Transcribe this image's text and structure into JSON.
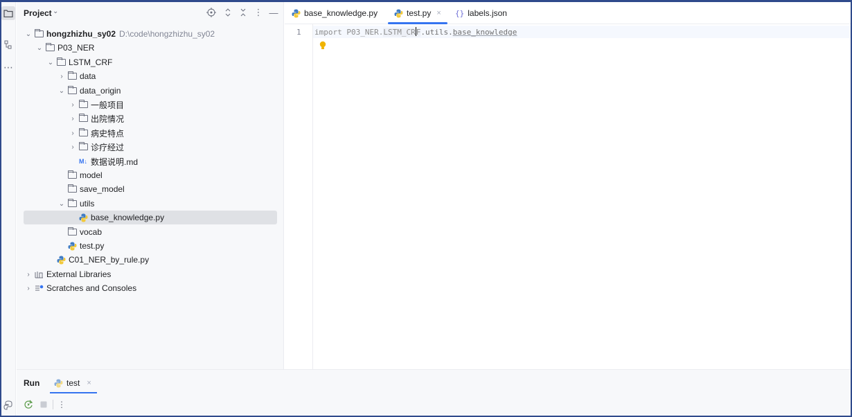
{
  "project_pane": {
    "title": "Project",
    "icons": [
      "locate-icon",
      "expand-all-icon",
      "collapse-all-icon",
      "options-icon",
      "hide-icon"
    ],
    "tree": [
      {
        "label": "hongzhizhu_sy02",
        "hint": "D:\\code\\hongzhizhu_sy02",
        "type": "folder",
        "expanded": true
      },
      {
        "label": "P03_NER",
        "type": "folder",
        "expanded": true
      },
      {
        "label": "LSTM_CRF",
        "type": "folder",
        "expanded": true
      },
      {
        "label": "data",
        "type": "folder",
        "expanded": false
      },
      {
        "label": "data_origin",
        "type": "folder",
        "expanded": true
      },
      {
        "label": "一般项目",
        "type": "folder",
        "expanded": false
      },
      {
        "label": "出院情况",
        "type": "folder",
        "expanded": false
      },
      {
        "label": "病史特点",
        "type": "folder",
        "expanded": false
      },
      {
        "label": "诊疗经过",
        "type": "folder",
        "expanded": false
      },
      {
        "label": "数据说明.md",
        "type": "markdown",
        "badge": "M↓"
      },
      {
        "label": "model",
        "type": "folder"
      },
      {
        "label": "save_model",
        "type": "folder"
      },
      {
        "label": "utils",
        "type": "folder",
        "expanded": true
      },
      {
        "label": "base_knowledge.py",
        "type": "python",
        "selected": true
      },
      {
        "label": "vocab",
        "type": "folder"
      },
      {
        "label": "test.py",
        "type": "python"
      },
      {
        "label": "C01_NER_by_rule.py",
        "type": "python"
      },
      {
        "label": "External Libraries",
        "type": "library",
        "expanded": false
      },
      {
        "label": "Scratches and Consoles",
        "type": "scratches",
        "expanded": false
      }
    ]
  },
  "editor": {
    "tabs": [
      {
        "label": "base_knowledge.py",
        "icon": "python-icon"
      },
      {
        "label": "test.py",
        "icon": "python-icon",
        "active": true,
        "close": "×"
      },
      {
        "label": "labels.json",
        "icon": "json-icon",
        "glyph": "{}"
      }
    ],
    "line_number": "1",
    "code": {
      "keyword": "import",
      "pkg": " P03_NER.",
      "mod_a": "LSTM_CR",
      "mod_b": "F",
      "rest_a": ".utils.",
      "rest_b": "base_knowledge"
    }
  },
  "run_panel": {
    "title": "Run",
    "tab_label": "test",
    "tab_close": "×"
  },
  "colors": {
    "accent": "#3574f0",
    "panel_bg": "#f7f8fa",
    "selection": "#dfe1e5",
    "python_blue": "#3f7cc4",
    "python_yellow": "#f2c93b",
    "bulb": "#f0b400"
  }
}
